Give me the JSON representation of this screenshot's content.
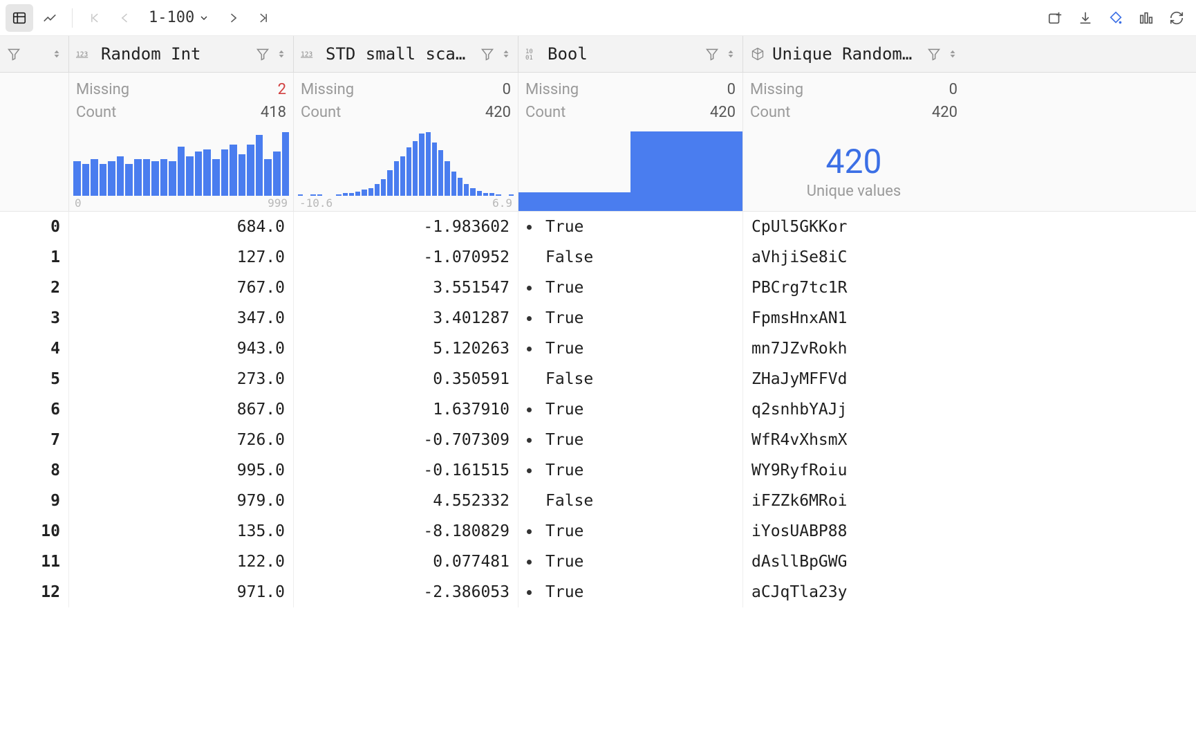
{
  "toolbar": {
    "range_label": "1-100"
  },
  "columns": [
    {
      "kind": "int",
      "name": "Random Int",
      "missing": 2,
      "missing_red": true,
      "count": 418,
      "axis_min": "0",
      "axis_max": "999"
    },
    {
      "kind": "float",
      "name": "STD small scale",
      "missing": 0,
      "missing_red": false,
      "count": 420,
      "axis_min": "-10.6",
      "axis_max": "6.9"
    },
    {
      "kind": "bool",
      "name": "Bool",
      "missing": 0,
      "missing_red": false,
      "count": 420
    },
    {
      "kind": "object",
      "name": "Unique Random …",
      "missing": 0,
      "missing_red": false,
      "count": 420,
      "unique": 420,
      "unique_label": "Unique values"
    }
  ],
  "chart_data": [
    {
      "type": "bar",
      "column": "Random Int",
      "xlim": [
        0,
        999
      ],
      "values": [
        14,
        13,
        15,
        13,
        14,
        16,
        13,
        15,
        15,
        14,
        15,
        14,
        20,
        16,
        18,
        19,
        15,
        19,
        21,
        17,
        21,
        25,
        15,
        18,
        26
      ]
    },
    {
      "type": "bar",
      "column": "STD small scale",
      "xlim": [
        -10.6,
        6.9
      ],
      "values": [
        1,
        0,
        1,
        1,
        0,
        0,
        1,
        2,
        2,
        3,
        5,
        6,
        9,
        13,
        20,
        27,
        31,
        38,
        43,
        49,
        50,
        42,
        36,
        27,
        19,
        14,
        9,
        6,
        4,
        2,
        2,
        1,
        0,
        1
      ]
    },
    {
      "type": "bar",
      "column": "Bool",
      "categories": [
        "False",
        "True"
      ],
      "values": [
        80,
        340
      ]
    }
  ],
  "rows": [
    {
      "idx": 0,
      "rint": "684.0",
      "std": "-1.983602",
      "bool": "True",
      "str": "CpUl5GKKor"
    },
    {
      "idx": 1,
      "rint": "127.0",
      "std": "-1.070952",
      "bool": "False",
      "str": "aVhjiSe8iC"
    },
    {
      "idx": 2,
      "rint": "767.0",
      "std": "3.551547",
      "bool": "True",
      "str": "PBCrg7tc1R"
    },
    {
      "idx": 3,
      "rint": "347.0",
      "std": "3.401287",
      "bool": "True",
      "str": "FpmsHnxAN1"
    },
    {
      "idx": 4,
      "rint": "943.0",
      "std": "5.120263",
      "bool": "True",
      "str": "mn7JZvRokh"
    },
    {
      "idx": 5,
      "rint": "273.0",
      "std": "0.350591",
      "bool": "False",
      "str": "ZHaJyMFFVd"
    },
    {
      "idx": 6,
      "rint": "867.0",
      "std": "1.637910",
      "bool": "True",
      "str": "q2snhbYAJj"
    },
    {
      "idx": 7,
      "rint": "726.0",
      "std": "-0.707309",
      "bool": "True",
      "str": "WfR4vXhsmX"
    },
    {
      "idx": 8,
      "rint": "995.0",
      "std": "-0.161515",
      "bool": "True",
      "str": "WY9RyfRoiu"
    },
    {
      "idx": 9,
      "rint": "979.0",
      "std": "4.552332",
      "bool": "False",
      "str": "iFZZk6MRoi"
    },
    {
      "idx": 10,
      "rint": "135.0",
      "std": "-8.180829",
      "bool": "True",
      "str": "iYosUABP88"
    },
    {
      "idx": 11,
      "rint": "122.0",
      "std": "0.077481",
      "bool": "True",
      "str": "dAsllBpGWG"
    },
    {
      "idx": 12,
      "rint": "971.0",
      "std": "-2.386053",
      "bool": "True",
      "str": "aCJqTla23y"
    }
  ],
  "labels": {
    "missing": "Missing",
    "count": "Count"
  }
}
